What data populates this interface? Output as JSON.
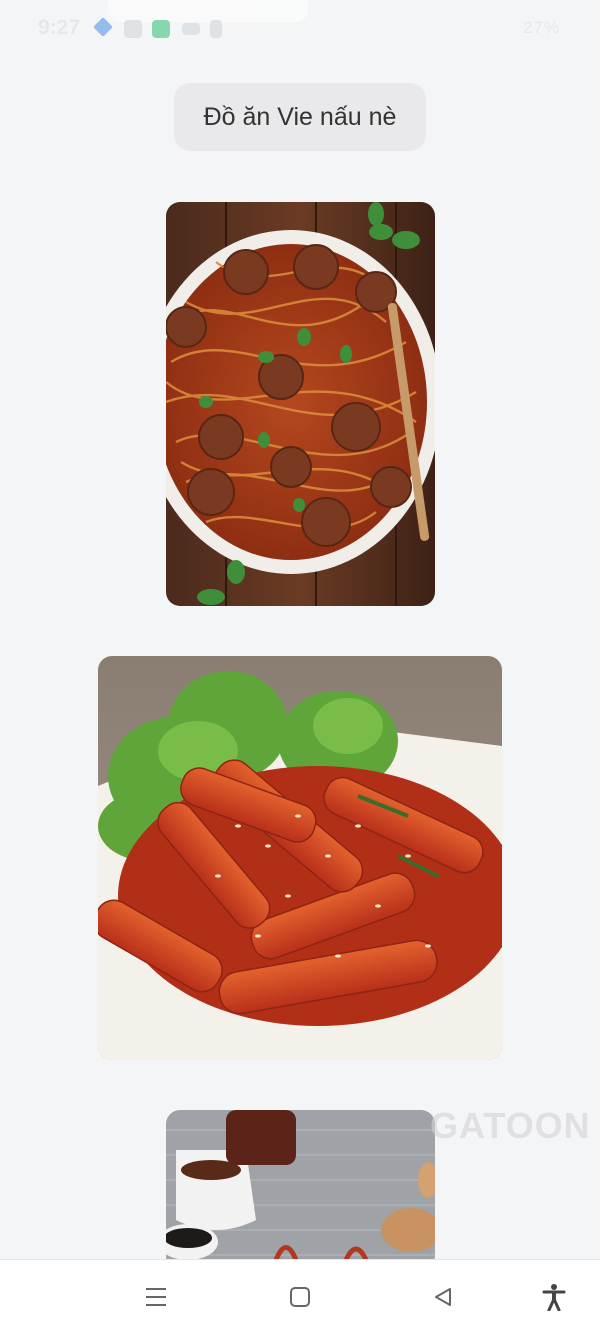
{
  "status_bar": {
    "time": "9:27",
    "battery": "27%"
  },
  "message": {
    "text": "Đồ ăn Vie nấu nè"
  },
  "photos": [
    {
      "name": "spaghetti-meatballs-photo"
    },
    {
      "name": "tteokbokki-photo"
    },
    {
      "name": "sauce-cups-photo"
    }
  ],
  "watermark": {
    "text": "GATOON"
  },
  "navigation": {
    "recent_icon": "menu-lines-icon",
    "home_icon": "square-home-icon",
    "back_icon": "triangle-back-icon",
    "accessibility_icon": "accessibility-person-icon"
  },
  "colors": {
    "background": "#f4f5f7",
    "bubble": "#e9e9eb",
    "nav_bar": "#ffffff"
  }
}
